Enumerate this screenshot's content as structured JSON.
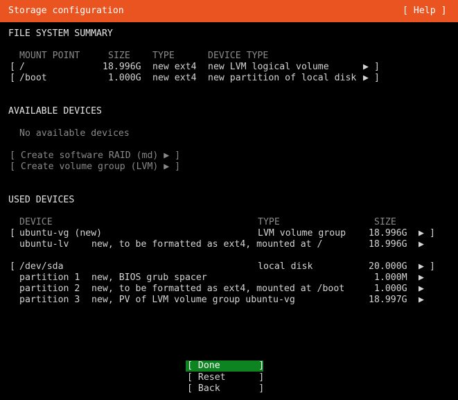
{
  "header": {
    "title": "Storage configuration",
    "help": "[ Help ]"
  },
  "fs_summary": {
    "title": "FILE SYSTEM SUMMARY",
    "columns": [
      "MOUNT POINT",
      "SIZE",
      "TYPE",
      "DEVICE TYPE"
    ],
    "rows": [
      {
        "open": "[",
        "mount": "/",
        "size": "18.996G",
        "type": "new ext4",
        "device_type": "new LVM logical volume",
        "arrow": "▶",
        "close": "]"
      },
      {
        "open": "[",
        "mount": "/boot",
        "size": "1.000G",
        "type": "new ext4",
        "device_type": "new partition of local disk",
        "arrow": "▶",
        "close": "]"
      }
    ]
  },
  "available": {
    "title": "AVAILABLE DEVICES",
    "empty": "No available devices",
    "actions": [
      "[ Create software RAID (md) ▶ ]",
      "[ Create volume group (LVM) ▶ ]"
    ]
  },
  "used": {
    "title": "USED DEVICES",
    "columns": [
      "DEVICE",
      "TYPE",
      "SIZE"
    ],
    "rows": [
      {
        "open": "[",
        "device": "ubuntu-vg (new)",
        "desc": "",
        "type": "LVM volume group",
        "size": "18.996G",
        "arrow": "▶",
        "close": "]"
      },
      {
        "open": "",
        "device": "ubuntu-lv",
        "desc": "new, to be formatted as ext4, mounted at /",
        "type": "",
        "size": "18.996G",
        "arrow": "▶",
        "close": ""
      },
      {
        "open": "[",
        "device": "/dev/sda",
        "desc": "",
        "type": "local disk",
        "size": "20.000G",
        "arrow": "▶",
        "close": "]"
      },
      {
        "open": "",
        "device": "partition 1",
        "desc": "new, BIOS grub spacer",
        "type": "",
        "size": "1.000M",
        "arrow": "▶",
        "close": ""
      },
      {
        "open": "",
        "device": "partition 2",
        "desc": "new, to be formatted as ext4, mounted at /boot",
        "type": "",
        "size": "1.000G",
        "arrow": "▶",
        "close": ""
      },
      {
        "open": "",
        "device": "partition 3",
        "desc": "new, PV of LVM volume group ubuntu-vg",
        "type": "",
        "size": "18.997G",
        "arrow": "▶",
        "close": ""
      }
    ]
  },
  "buttons": {
    "done": "[ Done       ]",
    "reset": "[ Reset      ]",
    "back": "[ Back       ]"
  },
  "colors": {
    "header": "#e95420",
    "selected": "#0e8420"
  }
}
